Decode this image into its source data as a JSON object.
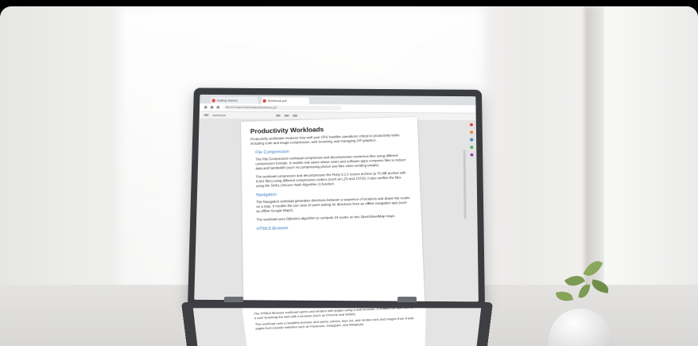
{
  "browser": {
    "tabs": [
      {
        "label": "Getting Started"
      },
      {
        "label": "Workbook.pdf"
      }
    ],
    "url": "file:///C:/Users/Test/Desktop/Workbook.pdf",
    "document_name": "workbook"
  },
  "document": {
    "title": "Productivity Workloads",
    "intro": "Productivity workloads measure how well your CPU handles operations critical to productivity tasks, including code and image compression, web browsing, and managing ZIP graphics.",
    "sections": [
      {
        "heading": "File Compression",
        "paragraphs": [
          "The File Compression workload compresses and decompresses numerous files using different compression formats. It models real cases where users and software apps compress files to reduce data and bandwidth (such as compressing photos and files when sending emails).",
          "The workload compresses and decompresses the Ruby 3.1.2 source archive (a 75 MB archive with 9,841 files) using different compression codecs (such as LZ4 and ZSTD). It also verifies the files using the SHA1 (Secure Hash Algorithm 1) function."
        ]
      },
      {
        "heading": "Navigation",
        "paragraphs": [
          "The Navigation workload generates directions between a sequence of locations and draws the routes on a map. It models the use case of users asking for directions from an offline navigation app (such as offline Google Maps).",
          "The workload uses Dijkstra's algorithm to compute 24 routes on two OpenStreetMap maps."
        ]
      },
      {
        "heading": "HTML5 Browser",
        "paragraphs": []
      }
    ],
    "second_screen_paragraphs": [
      "The HTML5 Browser workload opens and renders web pages using a web browser. It models the use case of a user browsing the web with a browser (such as Chrome and Safari).",
      "This workload uses a headless browser and opens, parses, lays out, and renders text and images from 6 web pages from popular websites such as Facebook, Instagram, and Wikipedia."
    ]
  },
  "colors": {
    "heading_blue": "#3c7cc7",
    "bezel": "#3a3c40",
    "favicon_red": "#d9473e"
  }
}
